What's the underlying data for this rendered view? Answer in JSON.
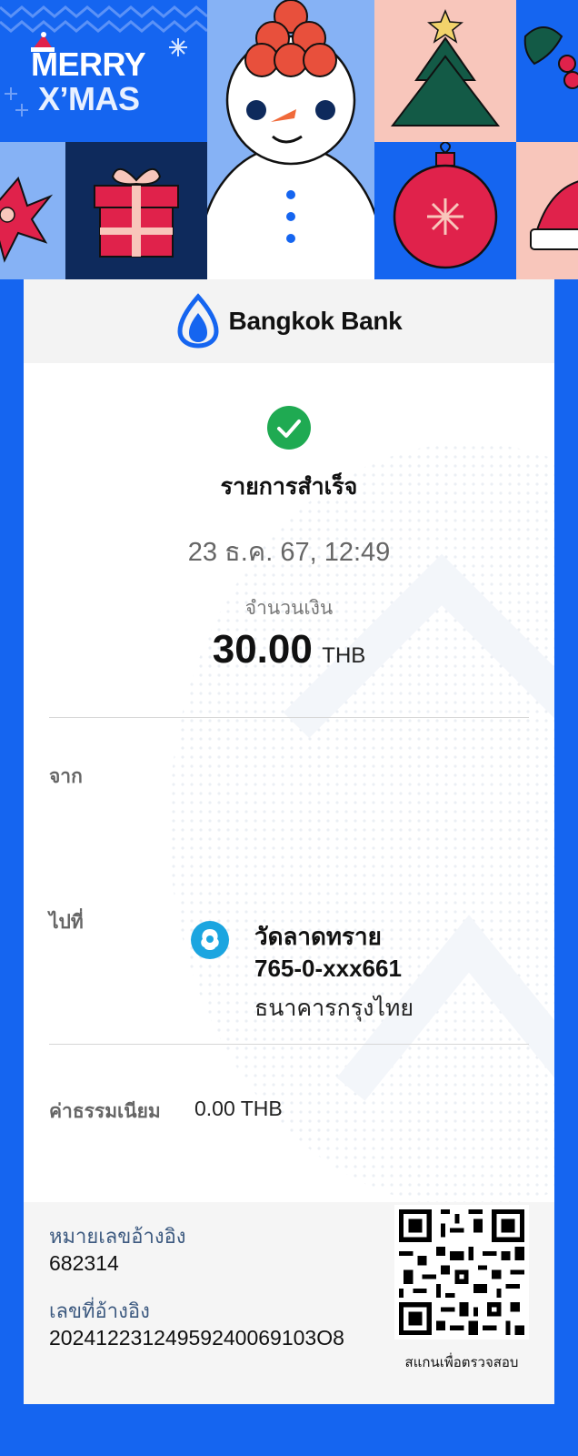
{
  "banner": {
    "line1": "MERRY",
    "line2": "X’MAS",
    "colors": {
      "blue": "#1565f0",
      "light_blue": "#86b2f5",
      "navy": "#0e2a5c",
      "red": "#e0224b",
      "pink": "#f8c6bb",
      "green": "#135a46"
    }
  },
  "header": {
    "brand_name": "Bangkok Bank",
    "logo_icon": "bangkok-bank-lotus-icon"
  },
  "status": {
    "icon": "check-circle-icon",
    "title": "รายการสำเร็จ",
    "color": "#1faa52"
  },
  "transaction": {
    "datetime": "23 ธ.ค. 67, 12:49",
    "amount_label": "จำนวนเงิน",
    "amount": "30.00",
    "currency": "THB"
  },
  "from": {
    "label": "จาก"
  },
  "to": {
    "label": "ไปที่",
    "bank_icon": "krungthai-bank-icon",
    "name": "วัดลาดทราย",
    "account": "765-0-xxx661",
    "bank": "ธนาคารกรุงไทย"
  },
  "fee": {
    "label": "ค่าธรรมเนียม",
    "value": "0.00 THB"
  },
  "reference": {
    "ref_label": "หมายเลขอ้างอิง",
    "ref_value": "682314",
    "ref2_label": "เลขที่อ้างอิง",
    "ref2_value": "20241223124959240069103O8",
    "qr_icon": "qr-code-icon",
    "qr_caption": "สแกนเพื่อตรวจสอบ"
  }
}
